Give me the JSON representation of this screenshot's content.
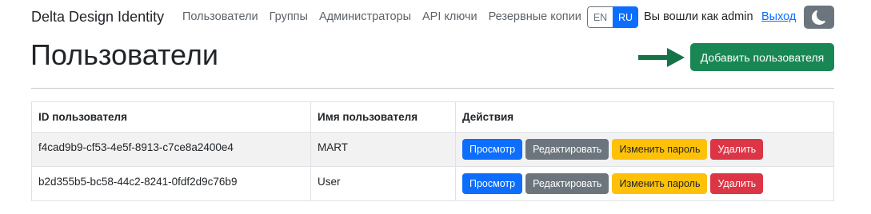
{
  "navbar": {
    "brand": "Delta Design Identity",
    "links": [
      "Пользователи",
      "Группы",
      "Администраторы",
      "API ключи",
      "Резервные копии"
    ],
    "lang": {
      "en": "EN",
      "ru": "RU",
      "active": "RU"
    },
    "logged_in": "Вы вошли как admin",
    "logout": "Выход",
    "theme_icon": "moon-icon"
  },
  "header": {
    "title": "Пользователи",
    "add_button": "Добавить пользователя",
    "arrow_icon": "arrow-right-icon"
  },
  "table": {
    "headers": [
      "ID пользователя",
      "Имя пользователя",
      "Действия"
    ],
    "rows": [
      {
        "id": "f4cad9b9-cf53-4e5f-8913-c7ce8a2400e4",
        "name": "MART"
      },
      {
        "id": "b2d355b5-bc58-44c2-8241-0fdf2d9c76b9",
        "name": "User"
      }
    ],
    "actions": {
      "view": "Просмотр",
      "edit": "Редактировать",
      "password": "Изменить пароль",
      "delete": "Удалить"
    }
  },
  "colors": {
    "primary": "#0d6efd",
    "secondary": "#6c757d",
    "success": "#198754",
    "warning": "#ffc107",
    "danger": "#dc3545"
  }
}
